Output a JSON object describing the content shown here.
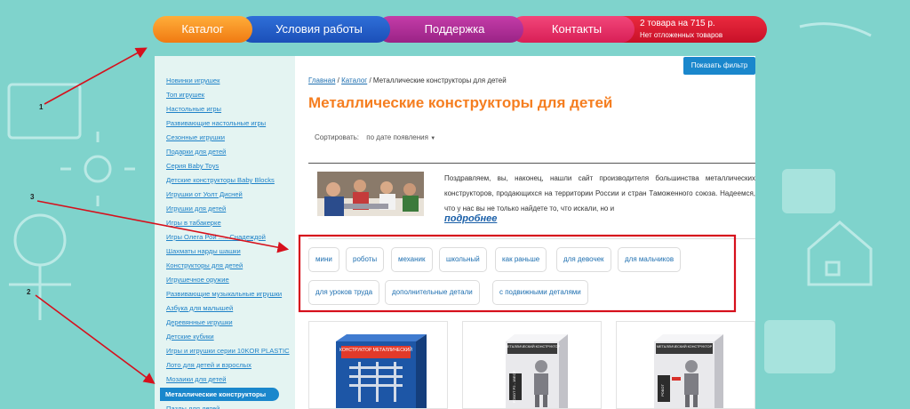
{
  "nav": {
    "items": [
      {
        "label": "Каталог"
      },
      {
        "label": "Условия работы"
      },
      {
        "label": "Поддержка"
      },
      {
        "label": "Контакты"
      }
    ]
  },
  "cart": {
    "summary": "2 товара на 715 р.",
    "deferred": "Нет отложенных товаров"
  },
  "sidebar": {
    "items": [
      {
        "label": "Новинки игрушек"
      },
      {
        "label": "Топ игрушек"
      },
      {
        "label": "Настольные игры"
      },
      {
        "label": "Развивающие настольные игры"
      },
      {
        "label": "Сезонные игрушки"
      },
      {
        "label": "Подарки для детей"
      },
      {
        "label": "Серия Baby Toys"
      },
      {
        "label": "Детские конструкторы Baby Blocks"
      },
      {
        "label": "Игрушки от Уолт Дисней"
      },
      {
        "label": "Игрушки для детей"
      },
      {
        "label": "Игры в табакерке"
      },
      {
        "label": "Игры Олега Рой ..... Снадеждой"
      },
      {
        "label": "Шахматы нарды шашки"
      },
      {
        "label": "Конструкторы для детей"
      },
      {
        "label": "Игрушечное оружие"
      },
      {
        "label": "Развивающие музыкальные игрушки"
      },
      {
        "label": "Азбука для малышей"
      },
      {
        "label": "Деревянные игрушки"
      },
      {
        "label": "Детские кубики"
      },
      {
        "label": "Игры и игрушки серии 10KOR PLASTIC"
      },
      {
        "label": "Лото для детей и взрослых"
      },
      {
        "label": "Мозаики для детей"
      },
      {
        "label": "Металлические конструкторы",
        "active": true
      },
      {
        "label": "Пазлы для детей"
      }
    ]
  },
  "content": {
    "filter_button": "Показать фильтр",
    "breadcrumb": {
      "home": "Главная",
      "sep1": " / ",
      "catalog": "Каталог",
      "sep2": " / ",
      "current": "Металлические конструкторы для детей"
    },
    "title": "Металлические конструкторы для детей",
    "sort_label": "Сортировать:",
    "sort_value": "по дате появления",
    "intro_text": "Поздравляем, вы, наконец, нашли сайт производителя большинства металлических конструкторов, продающихся на территории России и стран Таможенного союза. Надеемся, что у нас вы не только найдете то, что искали, но и",
    "more_link": "подробнее",
    "tags": [
      {
        "label": "мини"
      },
      {
        "label": "роботы"
      },
      {
        "label": "механик"
      },
      {
        "label": "школьный"
      },
      {
        "label": "как раньше"
      },
      {
        "label": "для девочек"
      },
      {
        "label": "для мальчиков"
      },
      {
        "label": "для уроков труда"
      },
      {
        "label": "дополнительные детали"
      },
      {
        "label": "с подвижными деталями"
      }
    ],
    "products": [
      {
        "box_title": "КОНСТРУКТОР МЕТАЛЛИЧЕСКИЙ"
      },
      {
        "box_title": "МЕТАЛЛИЧЕСКИЙ КОНСТРУКТОР",
        "box_sub": "РОБОТ Р2 - 1ВЕОР"
      },
      {
        "box_title": "МЕТАЛЛИЧЕСКИЙ КОНСТРУКТОР",
        "box_sub": "РОБОТ"
      }
    ]
  },
  "annotations": [
    "1",
    "2",
    "3"
  ],
  "colors": {
    "background": "#7fd3cc",
    "catalog": "#f07a12",
    "terms": "#1b4fb8",
    "support": "#9a2386",
    "contacts": "#d81f56",
    "cart": "#c81028",
    "accent_blue": "#1a87cc",
    "title_orange": "#f57e20",
    "annotation_red": "#d6101c"
  }
}
